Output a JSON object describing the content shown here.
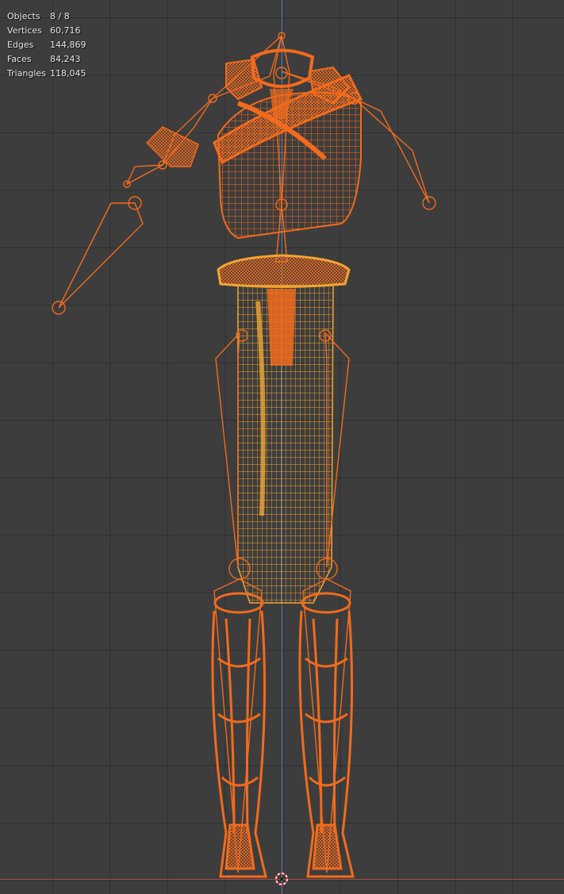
{
  "stats": [
    {
      "label": "Objects",
      "value": "8 / 8"
    },
    {
      "label": "Vertices",
      "value": "60,716"
    },
    {
      "label": "Edges",
      "value": "144,869"
    },
    {
      "label": "Faces",
      "value": "84,243"
    },
    {
      "label": "Triangles",
      "value": "118,045"
    }
  ],
  "colors": {
    "background": "#3d3d3d",
    "selection_orange": "#f26b1d",
    "active_orange": "#f3a531",
    "axis_y": "#5c86c7",
    "axis_x": "#b24a4a"
  },
  "icons": {
    "cursor": "3d-cursor-icon"
  }
}
